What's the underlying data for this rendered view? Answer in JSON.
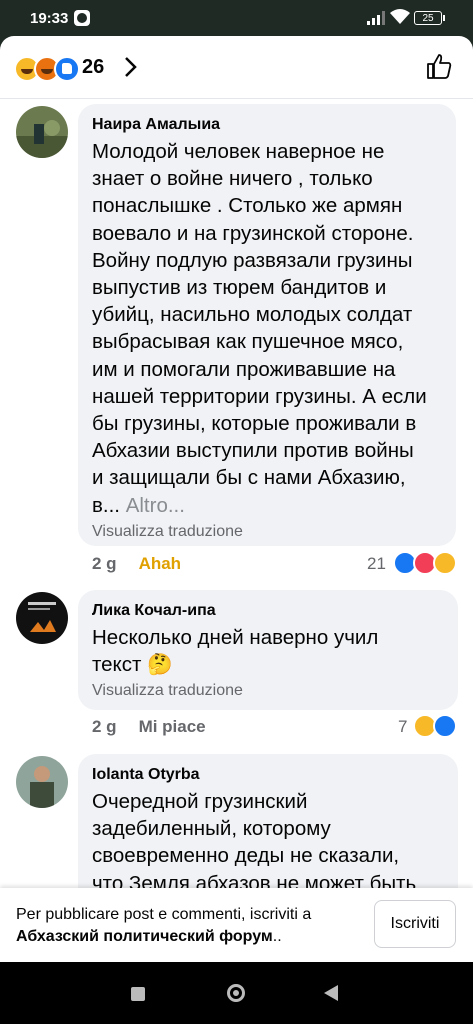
{
  "status": {
    "time": "19:33",
    "battery": "25"
  },
  "header": {
    "reaction_count": "26",
    "reactions": [
      "haha",
      "angry",
      "like"
    ]
  },
  "comments": [
    {
      "author": "Наира Амалыиа",
      "text": "Молодой человек наверное не\nзнает о войне ничего , только\nпонаслышке . Столько же армян\nвоевало и на грузинской стороне.\nВойну подлую развязали грузины\nвыпустив из тюрем бандитов и\nубийц,  насильно молодых солдат\nвыбрасывая как пушечное мясо,\nим и помогали проживавшие на\nнашей территории грузины. А если\nбы грузины, которые проживали в\nАбхазии выступили против войны\nи защищали бы с нами Абхазию,\nв...",
      "more": "Altro...",
      "translate": "Visualizza traduzione",
      "time": "2 g",
      "action": "Ahah",
      "reaction_count": "21",
      "reactions": [
        "like",
        "love",
        "haha"
      ]
    },
    {
      "author": "Лика Кочал-ипа",
      "text": "Несколько дней наверно учил\nтекст 🤔",
      "translate": "Visualizza traduzione",
      "time": "2 g",
      "action": "Mi piace",
      "reaction_count": "7",
      "reactions": [
        "haha",
        "like"
      ]
    },
    {
      "author": "Iolanta Otyrba",
      "text": "Очередной грузинский\nзадебиленный, которому\nсвоевременно деды не сказали,\nчто Земля абхазов не может быть"
    }
  ],
  "footer": {
    "prompt": "Per pubblicare post e commenti, iscriviti a",
    "group": "Абхазский политический форум",
    "suffix": "..",
    "button": "Iscriviti"
  },
  "colors": {
    "accent": "#1877f2",
    "haha": "#f7b928",
    "love": "#f33e58",
    "bubble": "#f0f2f5"
  }
}
